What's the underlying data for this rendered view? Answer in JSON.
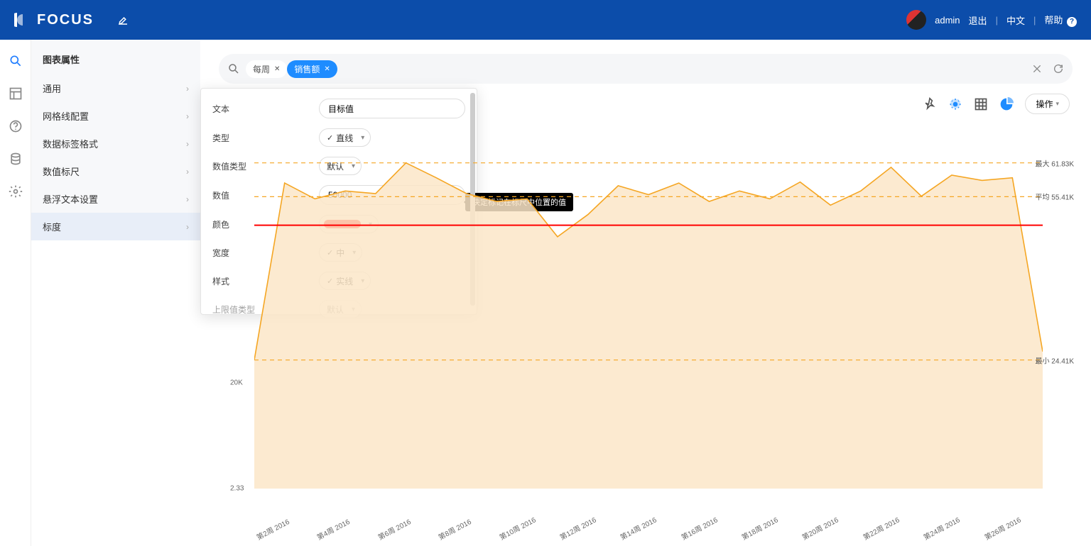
{
  "header": {
    "brand": "FOCUS",
    "user": "admin",
    "logout": "退出",
    "lang": "中文",
    "help": "帮助"
  },
  "sidepanel": {
    "title": "图表属性",
    "items": [
      "通用",
      "网格线配置",
      "数据标签格式",
      "数值标尺",
      "悬浮文本设置",
      "标度"
    ],
    "active_index": 5
  },
  "search": {
    "chips": [
      {
        "label": "每周",
        "style": "gray"
      },
      {
        "label": "销售额",
        "style": "blue"
      }
    ]
  },
  "toolbar": {
    "action_label": "操作"
  },
  "popover": {
    "rows": {
      "text": {
        "label": "文本",
        "value": "目标值"
      },
      "type": {
        "label": "类型",
        "value": "直线"
      },
      "value_type": {
        "label": "数值类型",
        "value": "默认"
      },
      "value": {
        "label": "数值",
        "value": "50000"
      },
      "color": {
        "label": "颜色",
        "hex": "#ff0000"
      },
      "width": {
        "label": "宽度",
        "value": "中"
      },
      "style": {
        "label": "样式",
        "value": "实线"
      },
      "upper_type": {
        "label": "上限值类型",
        "value": "默认"
      }
    },
    "tooltip": "决定标记在标尺中位置的值"
  },
  "chart_data": {
    "type": "area",
    "xlabel": "",
    "ylabel": "",
    "ylim": [
      2.33,
      70000
    ],
    "y_ticks": [
      {
        "v": 20000,
        "label": "20K"
      },
      {
        "v": 2.33,
        "label": "2.33"
      }
    ],
    "categories": [
      "第2周 2016",
      "第4周 2016",
      "第6周 2016",
      "第8周 2016",
      "第10周 2016",
      "第12周 2016",
      "第14周 2016",
      "第16周 2016",
      "第18周 2016",
      "第20周 2016",
      "第22周 2016",
      "第24周 2016",
      "第26周 2016"
    ],
    "series": [
      {
        "name": "销售额",
        "values": [
          24410,
          58000,
          55000,
          56500,
          56000,
          61830,
          59000,
          56000,
          54500,
          55000,
          47800,
          52000,
          57500,
          55800,
          58000,
          54500,
          56500,
          55000,
          58200,
          53800,
          56500,
          61000,
          55500,
          59500,
          58500,
          59000,
          26000
        ]
      }
    ],
    "marklines": {
      "target": {
        "label": "目标值",
        "value": 50000,
        "color": "#ff0000",
        "dash": false
      },
      "max": {
        "label": "最大 61.83K",
        "value": 61830,
        "color": "#f5a623",
        "dash": true
      },
      "avg": {
        "label": "平均 55.41K",
        "value": 55410,
        "color": "#f5a623",
        "dash": true
      },
      "min": {
        "label": "最小 24.41K",
        "value": 24410,
        "color": "#f5a623",
        "dash": true
      }
    }
  }
}
